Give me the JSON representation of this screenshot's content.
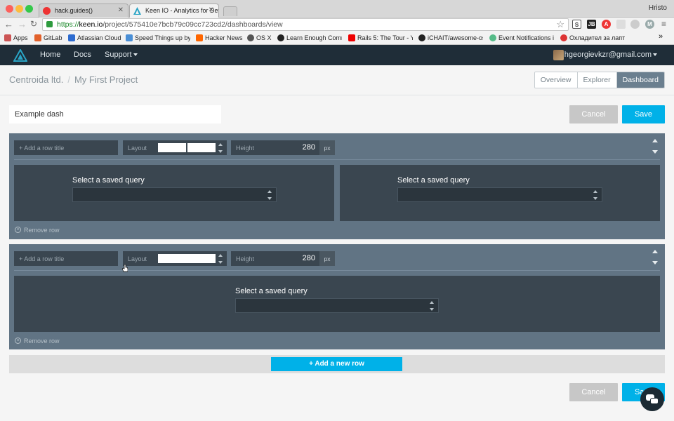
{
  "browser": {
    "tabs": [
      {
        "title": "hack.guides()",
        "active": false
      },
      {
        "title": "Keen IO - Analytics for Dev",
        "active": true
      }
    ],
    "user_name": "Hristo",
    "url_https": "https://",
    "url_host": "keen.io",
    "url_path": "/project/575410e7bcb79c09cc723cd2/dashboards/view",
    "bookmarks": [
      "Apps",
      "GitLab",
      "Atlassian Cloud",
      "Speed Things up by",
      "Hacker News",
      "OS X",
      "Learn Enough Comm",
      "Rails 5: The Tour - Y",
      "iCHAIT/awesome-osx",
      "Event Notifications i",
      "Охладител за лапто"
    ],
    "colors": {
      "accent": "#00b1e8",
      "nav_bg": "#1f2d38",
      "row_bg": "#617484",
      "tile_bg": "#3a4650"
    }
  },
  "nav": {
    "home": "Home",
    "docs": "Docs",
    "support": "Support",
    "account": "hgeorgievkzr@gmail.com"
  },
  "header": {
    "org": "Centroida ltd.",
    "separator": "/",
    "project": "My First Project",
    "tabs": [
      {
        "label": "Overview",
        "active": false
      },
      {
        "label": "Explorer",
        "active": false
      },
      {
        "label": "Dashboard",
        "active": true
      }
    ]
  },
  "dashboard": {
    "name": "Example dash",
    "cancel_label": "Cancel",
    "save_label": "Save",
    "add_row_label": "+ Add a new row",
    "rows": [
      {
        "title_placeholder": "+ Add a row title",
        "layout_label": "Layout",
        "layout_columns": 2,
        "height_label": "Height",
        "height_value": "280",
        "height_unit": "px",
        "remove_label": "Remove row",
        "tiles": [
          {
            "label": "Select a saved query"
          },
          {
            "label": "Select a saved query"
          }
        ]
      },
      {
        "title_placeholder": "+ Add a row title",
        "layout_label": "Layout",
        "layout_columns": 1,
        "height_label": "Height",
        "height_value": "280",
        "height_unit": "px",
        "remove_label": "Remove row",
        "tiles": [
          {
            "label": "Select a saved query"
          }
        ]
      }
    ]
  },
  "footer": {
    "cancel_label": "Cancel",
    "save_label": "Save"
  }
}
